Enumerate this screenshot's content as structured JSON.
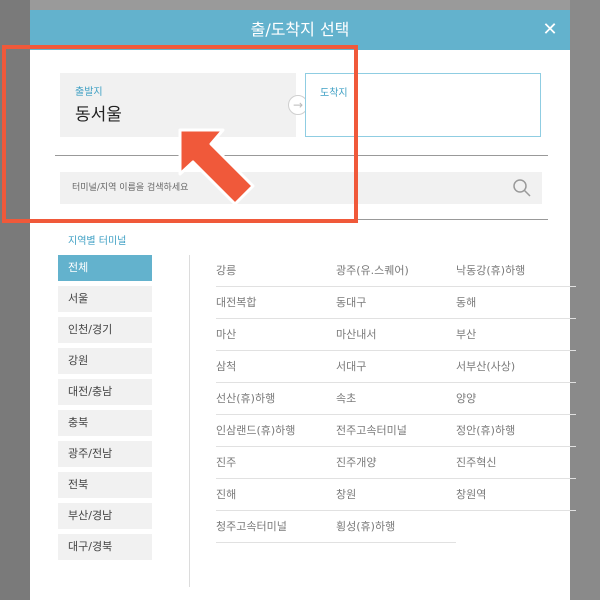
{
  "modal": {
    "title": "출/도착지 선택",
    "close": "✕"
  },
  "departure": {
    "label": "출발지",
    "value": "동서울"
  },
  "arrival": {
    "label": "도착지"
  },
  "search": {
    "placeholder": "터미널/지역 이름을 검색하세요"
  },
  "section_title": "지역별 터미널",
  "regions": [
    "전체",
    "서울",
    "인천/경기",
    "강원",
    "대전/충남",
    "충북",
    "광주/전남",
    "전북",
    "부산/경남",
    "대구/경북"
  ],
  "terminals": [
    [
      "강릉",
      "광주(유.스퀘어)",
      "낙동강(휴)하행"
    ],
    [
      "대전복합",
      "동대구",
      "동해"
    ],
    [
      "마산",
      "마산내서",
      "부산"
    ],
    [
      "삼척",
      "서대구",
      "서부산(사상)"
    ],
    [
      "선산(휴)하행",
      "속초",
      "양양"
    ],
    [
      "인삼랜드(휴)하행",
      "전주고속터미널",
      "정안(휴)하행"
    ],
    [
      "진주",
      "진주개양",
      "진주혁신"
    ],
    [
      "진해",
      "창원",
      "창원역"
    ],
    [
      "청주고속터미널",
      "횡성(휴)하행",
      ""
    ]
  ],
  "colors": {
    "header": "#63b2cd",
    "accent_label": "#3fa0c4",
    "annotation": "#f0593a"
  }
}
